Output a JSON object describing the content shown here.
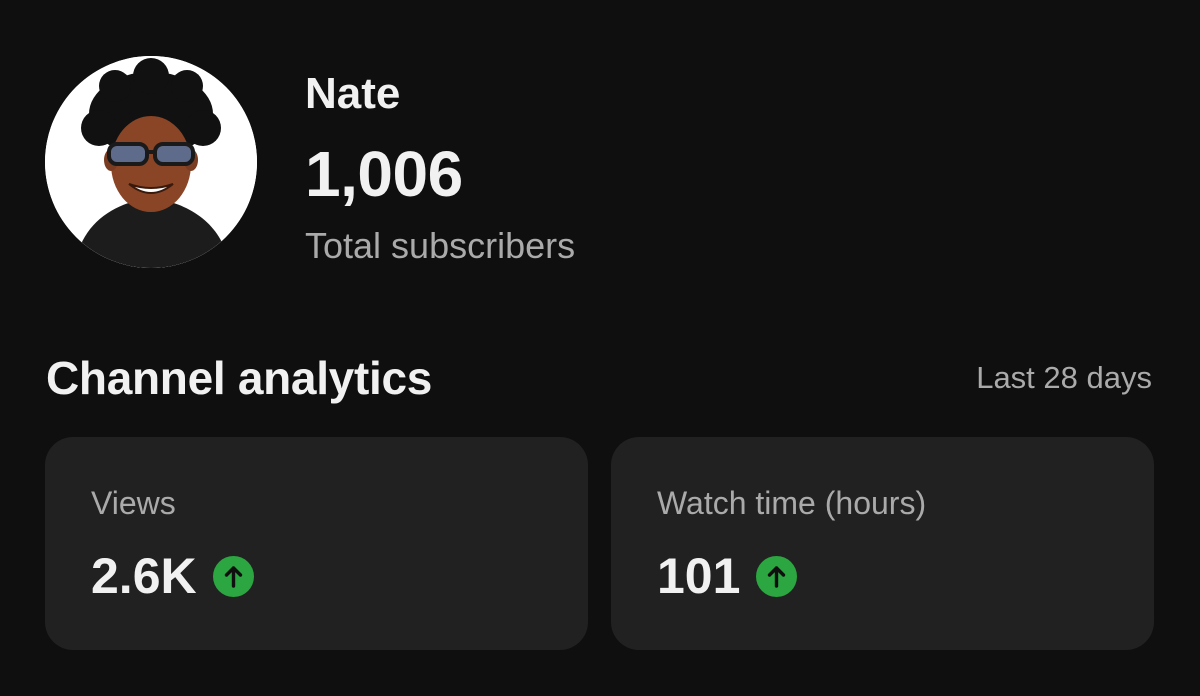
{
  "channel": {
    "name": "Nate",
    "subscriber_count": "1,006",
    "subscriber_label": "Total subscribers",
    "avatar_icon": "profile-photo"
  },
  "analytics": {
    "title": "Channel analytics",
    "period": "Last 28 days",
    "metrics": [
      {
        "label": "Views",
        "value": "2.6K",
        "trend": "up",
        "trend_icon": "arrow-up-icon"
      },
      {
        "label": "Watch time (hours)",
        "value": "101",
        "trend": "up",
        "trend_icon": "arrow-up-icon"
      }
    ]
  },
  "colors": {
    "background": "#0f0f0f",
    "card": "#212121",
    "primary_text": "#f1f1f1",
    "secondary_text": "#aaaaaa",
    "trend_up": "#2ba640"
  }
}
